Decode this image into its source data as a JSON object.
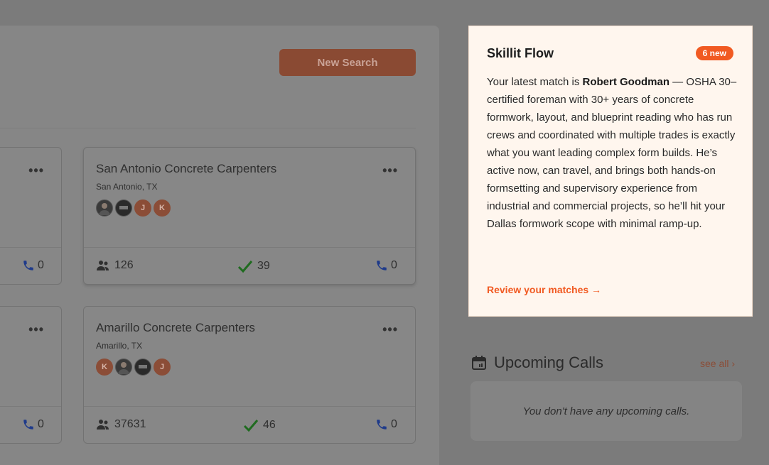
{
  "toolbar": {
    "new_search_label": "New Search"
  },
  "cards": {
    "left_top": {
      "phone_count": "0"
    },
    "left_bottom": {
      "phone_count": "0"
    },
    "san_antonio": {
      "title": "San Antonio Concrete Carpenters",
      "location": "San Antonio, TX",
      "avatars": [
        "photo",
        "logo",
        "J",
        "K"
      ],
      "members": "126",
      "accepted": "39",
      "calls": "0"
    },
    "amarillo": {
      "title": "Amarillo Concrete Carpenters",
      "location": "Amarillo, TX",
      "avatars": [
        "K",
        "photo",
        "logo",
        "J"
      ],
      "members": "37631",
      "accepted": "46",
      "calls": "0"
    }
  },
  "flow": {
    "title": "Skillit Flow",
    "badge": "6 new",
    "intro": "Your latest match is ",
    "name": "Robert Goodman",
    "body": " — OSHA 30–certified foreman with 30+ years of concrete formwork, layout, and blueprint reading who has run crews and coordinated with multiple trades is exactly what you want leading complex form builds. He’s active now, can travel, and brings both hands-on formsetting and supervisory experience from industrial and commercial projects, so he’ll hit your Dallas formwork scope with minimal ramp-up.",
    "link": "Review your matches →"
  },
  "upcoming": {
    "title": "Upcoming Calls",
    "see_all": "see all ›",
    "empty": "You don't have any upcoming calls."
  },
  "colors": {
    "accent": "#f15a22",
    "flow_bg": "#fff6ee",
    "phone": "#1e3a8a",
    "check": "#1f6b1f"
  }
}
